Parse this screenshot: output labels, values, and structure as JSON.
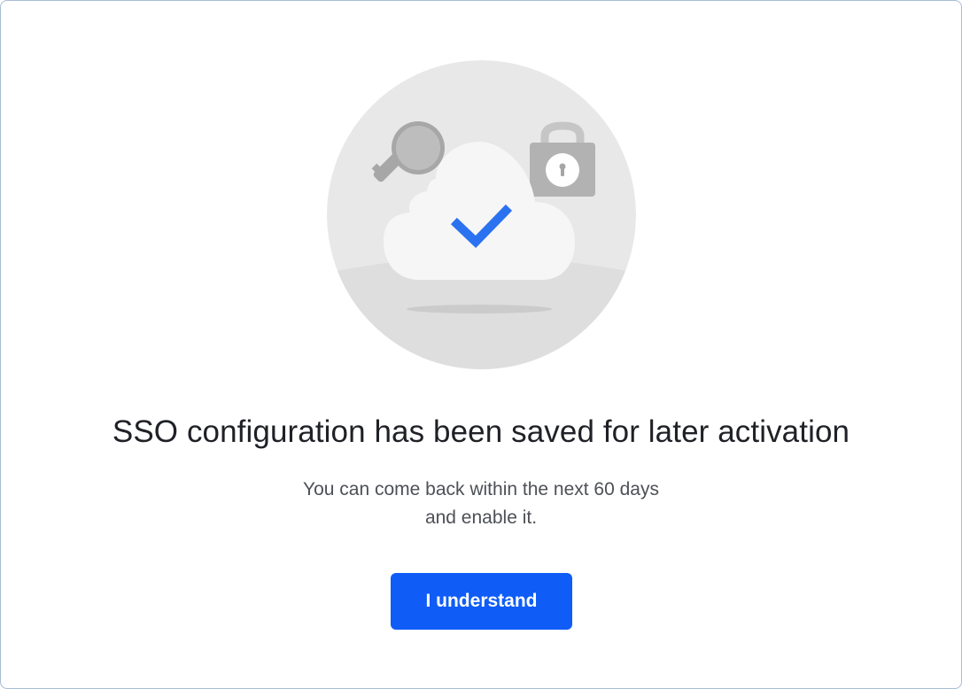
{
  "dialog": {
    "illustration": {
      "icons": [
        "key-icon",
        "lock-icon",
        "cloud-icon",
        "checkmark-icon"
      ],
      "check_color": "#2b72f0"
    },
    "title": "SSO configuration has been saved for later activation",
    "subtitle_line1": "You can come back within the next 60 days",
    "subtitle_line2": "and enable it.",
    "button_label": "I understand",
    "button_color": "#0f5cf7"
  }
}
